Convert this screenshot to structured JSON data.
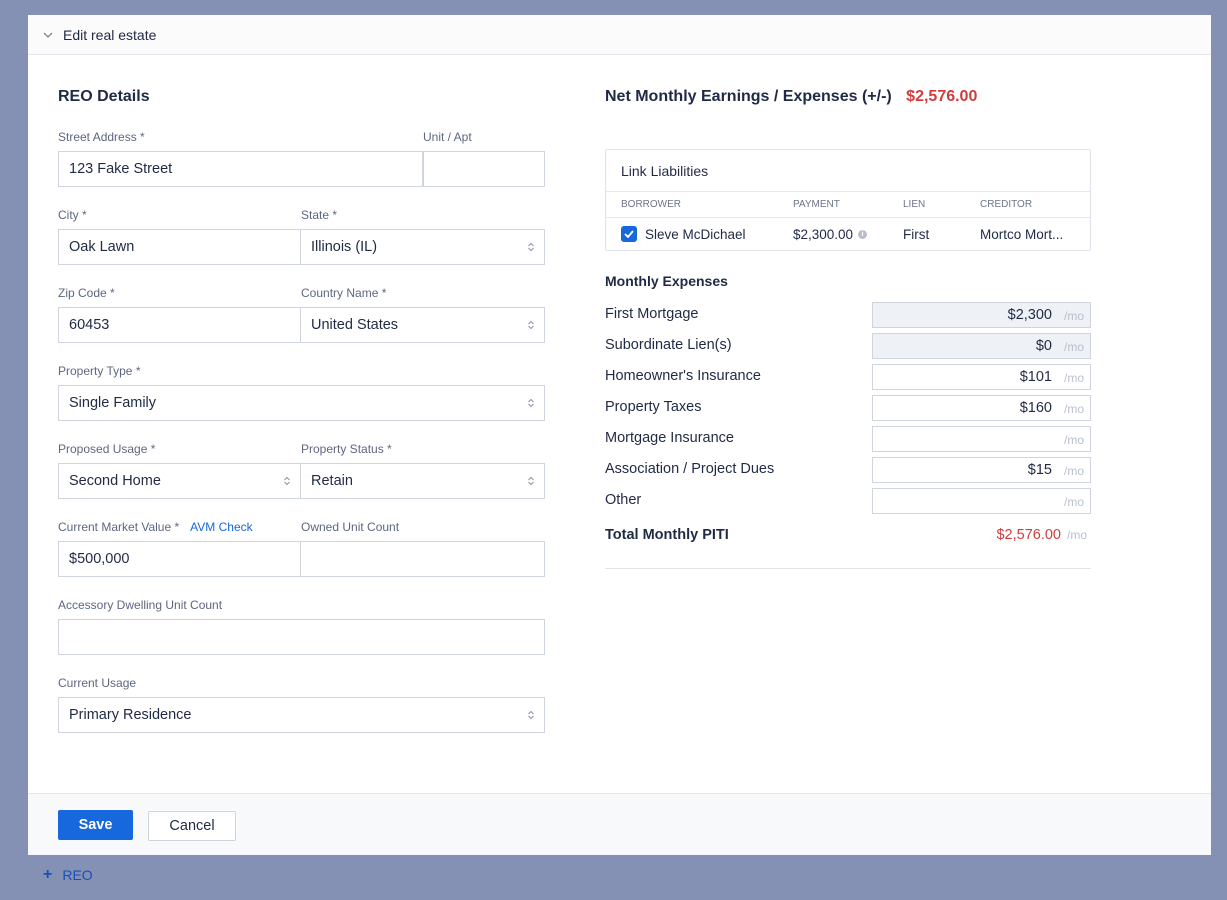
{
  "panel": {
    "title": "Edit real estate"
  },
  "reo": {
    "heading": "REO Details",
    "street_label": "Street Address *",
    "street_value": "123 Fake Street",
    "unit_label": "Unit / Apt",
    "unit_value": "",
    "city_label": "City *",
    "city_value": "Oak Lawn",
    "state_label": "State *",
    "state_value": "Illinois (IL)",
    "zip_label": "Zip Code *",
    "zip_value": "60453",
    "country_label": "Country Name *",
    "country_value": "United States",
    "property_type_label": "Property Type *",
    "property_type_value": "Single Family",
    "proposed_usage_label": "Proposed Usage *",
    "proposed_usage_value": "Second Home",
    "property_status_label": "Property Status *",
    "property_status_value": "Retain",
    "market_value_label": "Current Market Value *",
    "avm_link": "AVM Check",
    "market_value_value": "$500,000",
    "owned_unit_label": "Owned Unit Count",
    "owned_unit_value": "",
    "adu_label": "Accessory Dwelling Unit Count",
    "adu_value": "",
    "current_usage_label": "Current Usage",
    "current_usage_value": "Primary Residence"
  },
  "net": {
    "label": "Net Monthly Earnings / Expenses (+/-)",
    "value": "$2,576.00",
    "value_color": "#d23c3c"
  },
  "liabilities": {
    "title": "Link Liabilities",
    "columns": [
      "BORROWER",
      "PAYMENT",
      "LIEN",
      "CREDITOR"
    ],
    "rows": [
      {
        "checked": true,
        "borrower": "Sleve McDichael",
        "payment": "$2,300.00",
        "lien": "First",
        "creditor": "Mortco Mort..."
      }
    ]
  },
  "expenses": {
    "title": "Monthly Expenses",
    "unit": "/mo",
    "items": [
      {
        "label": "First Mortgage",
        "value": "$2,300",
        "readonly": true
      },
      {
        "label": "Subordinate Lien(s)",
        "value": "$0",
        "readonly": true
      },
      {
        "label": "Homeowner's Insurance",
        "value": "$101",
        "readonly": false
      },
      {
        "label": "Property Taxes",
        "value": "$160",
        "readonly": false
      },
      {
        "label": "Mortgage Insurance",
        "value": "",
        "readonly": false
      },
      {
        "label": "Association / Project Dues",
        "value": "$15",
        "readonly": false
      },
      {
        "label": "Other",
        "value": "",
        "readonly": false
      }
    ],
    "total_label": "Total Monthly PITI",
    "total_value": "$2,576.00"
  },
  "footer": {
    "save_label": "Save",
    "cancel_label": "Cancel"
  },
  "add_reo_label": "REO"
}
